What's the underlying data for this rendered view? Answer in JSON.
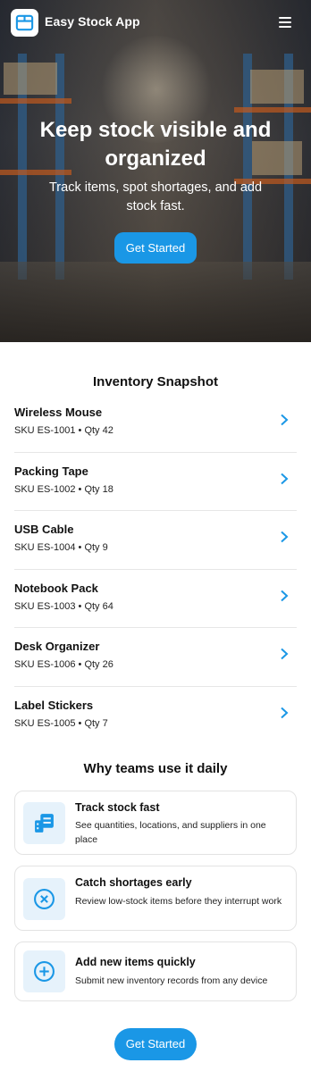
{
  "app": {
    "title": "Easy Stock App"
  },
  "hero": {
    "title": "Keep stock visible and organized",
    "subtitle": "Track items, spot shortages, and add stock fast.",
    "cta_label": "Get Started"
  },
  "snapshot": {
    "title": "Inventory Snapshot",
    "items": [
      {
        "name": "Wireless Mouse",
        "meta": "SKU ES-1001 • Qty 42"
      },
      {
        "name": "Packing Tape",
        "meta": "SKU ES-1002 • Qty 18"
      },
      {
        "name": "USB Cable",
        "meta": "SKU ES-1004 • Qty 9"
      },
      {
        "name": "Notebook Pack",
        "meta": "SKU ES-1003 • Qty 64"
      },
      {
        "name": "Desk Organizer",
        "meta": "SKU ES-1006 • Qty 26"
      },
      {
        "name": "Label Stickers",
        "meta": "SKU ES-1005 • Qty 7"
      }
    ]
  },
  "features": {
    "title": "Why teams use it daily",
    "cards": [
      {
        "icon": "list-icon",
        "title": "Track stock fast",
        "desc": "See quantities, locations, and suppliers in one place"
      },
      {
        "icon": "x-circle-icon",
        "title": "Catch shortages early",
        "desc": "Review low-stock items before they interrupt work"
      },
      {
        "icon": "plus-circle-icon",
        "title": "Add new items quickly",
        "desc": "Submit new inventory records from any device"
      }
    ]
  },
  "footer": {
    "cta_label": "Get Started"
  },
  "colors": {
    "accent": "#1a97e6",
    "icon_bg": "#e6f2fb"
  }
}
